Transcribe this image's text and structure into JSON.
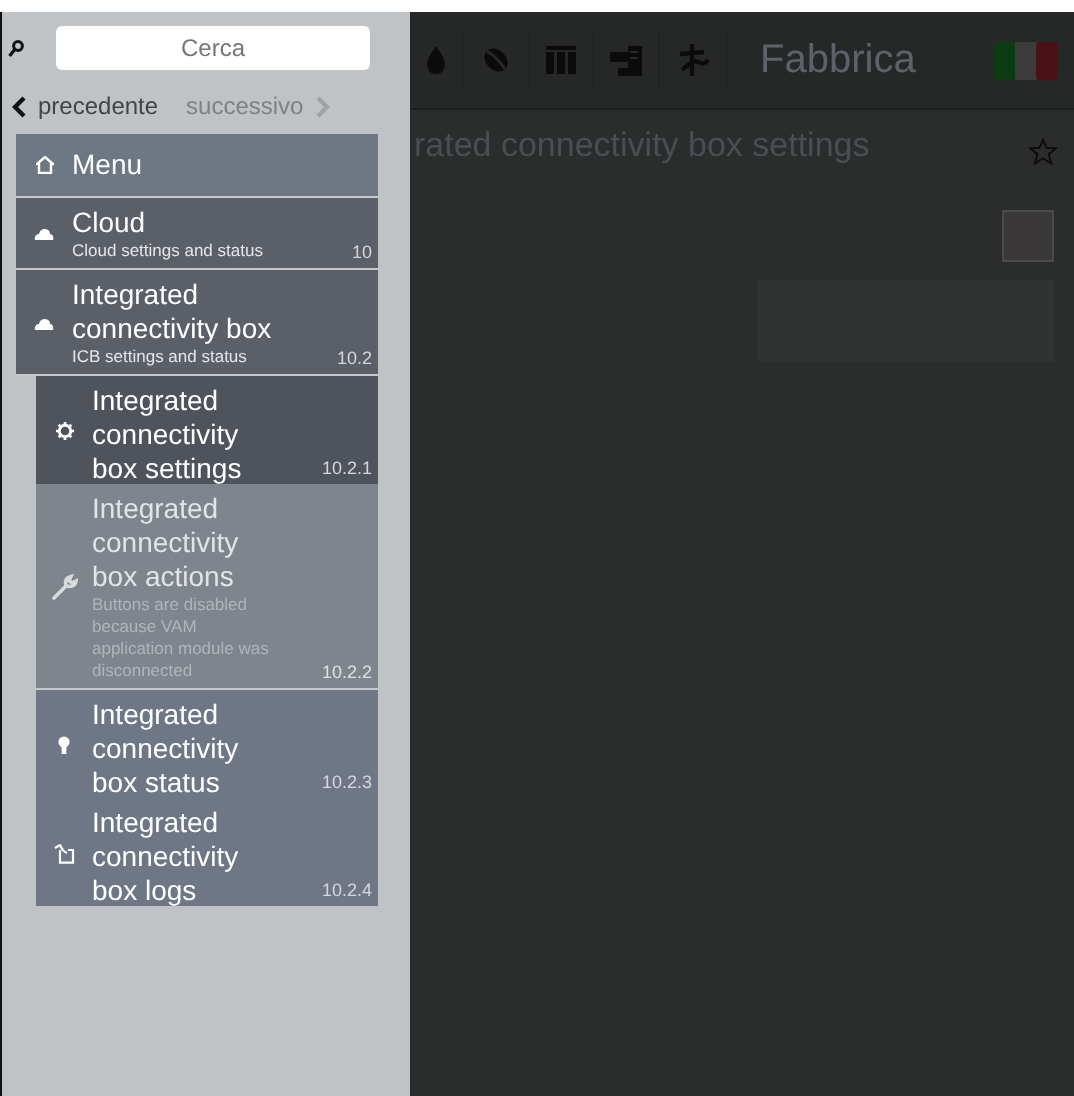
{
  "sidebar": {
    "search": {
      "placeholder": "Cerca"
    },
    "nav": [
      {
        "label": "precedente",
        "disabled": false
      },
      {
        "label": "successivo",
        "disabled": true
      }
    ],
    "items": [
      {
        "kind": "header",
        "title": "Menu",
        "selected": false,
        "disabled": false
      },
      {
        "kind": "section",
        "title": "Cloud",
        "subtitle": "Cloud settings and status",
        "number": "10",
        "selected": false,
        "disabled": false
      },
      {
        "kind": "section",
        "title": "Integrated connectivity box",
        "subtitle": "ICB settings and status",
        "number": "10.2",
        "selected": false,
        "disabled": false,
        "children": [
          {
            "kind": "page",
            "title": "Integrated connectivity box settings",
            "number": "10.2.1",
            "selected": true,
            "disabled": false
          },
          {
            "kind": "page",
            "title": "Integrated connectivity box actions",
            "subtitle": "Buttons are disabled because VAM application module was disconnected",
            "number": "10.2.2",
            "selected": false,
            "disabled": true
          },
          {
            "kind": "page",
            "title": "Integrated connectivity box status",
            "number": "10.2.3",
            "selected": false,
            "disabled": false
          },
          {
            "kind": "page",
            "title": "Integrated connectivity box logs",
            "number": "10.2.4",
            "selected": false,
            "disabled": false
          }
        ]
      }
    ]
  },
  "header": {
    "title": "Fabbrica"
  },
  "page": {
    "title": "rated connectivity box settings",
    "checkbox": {
      "checked": false
    }
  }
}
